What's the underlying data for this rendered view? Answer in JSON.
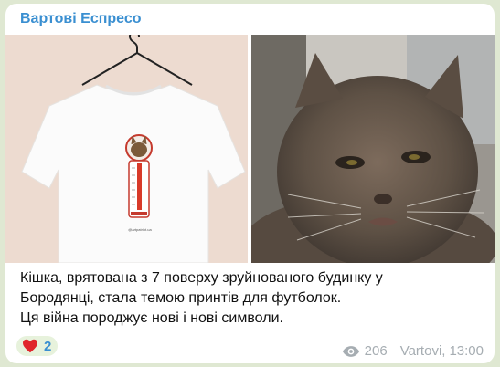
{
  "channel": {
    "name": "Вартові Еспресо"
  },
  "post": {
    "caption_lines": [
      "Кішка, врятована з 7 поверху зруйнованого будинку у",
      "Бородянці, стала темою принтів для футболок.",
      "Ця війна породжує нові і нові символи."
    ],
    "tshirt_print_text": "@artpatriot.ua",
    "tshirt_print_label": "PUSYA-PSIKHIA"
  },
  "reactions": [
    {
      "icon": "red-heart-icon",
      "count": "2"
    }
  ],
  "footer": {
    "views_icon": "eye-icon",
    "views": "206",
    "author": "Vartovi,",
    "time": "13:00"
  },
  "colors": {
    "background": "#dfe8d2",
    "bubble": "#ffffff",
    "accent": "#3a8fd1",
    "muted": "#a6adb2",
    "reaction_bg": "#e7f2dc",
    "heart": "#e0262b"
  }
}
